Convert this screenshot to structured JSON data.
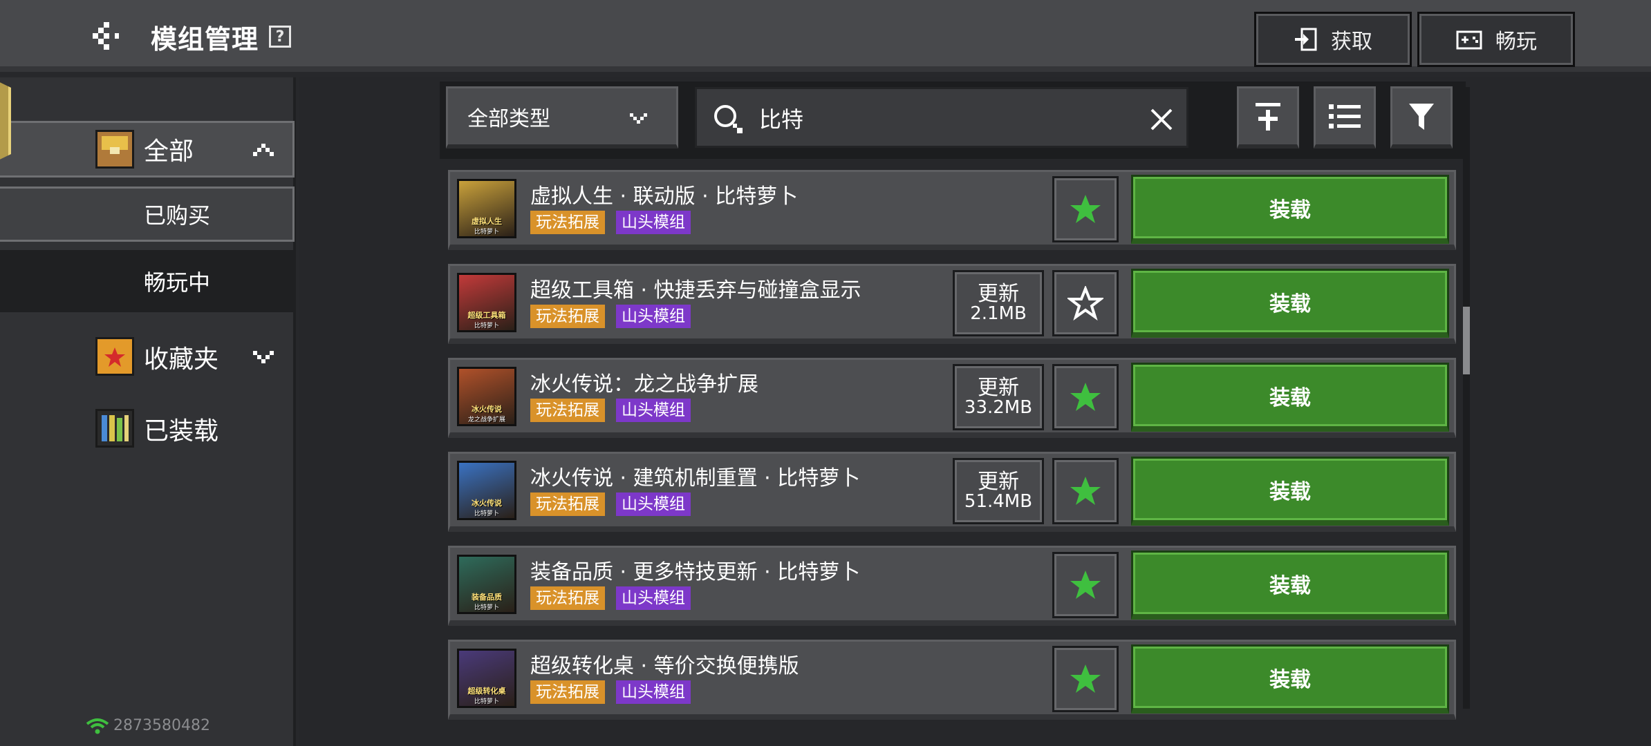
{
  "header": {
    "title": "模组管理",
    "help_icon": "question-icon",
    "back_icon": "back-arrow-icon",
    "get_label": "获取",
    "play_label": "畅玩"
  },
  "sidebar": {
    "all": "全部",
    "bought": "已购买",
    "playing": "畅玩中",
    "favorites": "收藏夹",
    "installed": "已装载",
    "net_id": "2873580482"
  },
  "toolbar": {
    "type_select": "全部类型",
    "search_value": "比特"
  },
  "mods": [
    {
      "title": "虚拟人生 · 联动版 · 比特萝卜",
      "tags": [
        "玩法拓展",
        "山头模组"
      ],
      "update": null,
      "favorited": true,
      "action": "装载",
      "thumb_text": [
        "虚拟人生",
        "比特萝卜"
      ],
      "thumb_color": "#c9a13b"
    },
    {
      "title": "超级工具箱 · 快捷丢弃与碰撞盒显示",
      "tags": [
        "玩法拓展",
        "山头模组"
      ],
      "update": {
        "label": "更新",
        "size": "2.1MB"
      },
      "favorited": false,
      "action": "装载",
      "thumb_text": [
        "超级工具箱",
        "比特萝卜"
      ],
      "thumb_color": "#c23a3a"
    },
    {
      "title": "冰火传说：龙之战争扩展",
      "tags": [
        "玩法拓展",
        "山头模组"
      ],
      "update": {
        "label": "更新",
        "size": "33.2MB"
      },
      "favorited": true,
      "action": "装载",
      "thumb_text": [
        "冰火传说",
        "龙之战争扩展"
      ],
      "thumb_color": "#b0512a"
    },
    {
      "title": "冰火传说 · 建筑机制重置 · 比特萝卜",
      "tags": [
        "玩法拓展",
        "山头模组"
      ],
      "update": {
        "label": "更新",
        "size": "51.4MB"
      },
      "favorited": true,
      "action": "装载",
      "thumb_text": [
        "冰火传说",
        "比特萝卜"
      ],
      "thumb_color": "#3a72c2"
    },
    {
      "title": "装备品质 · 更多特技更新 · 比特萝卜",
      "tags": [
        "玩法拓展",
        "山头模组"
      ],
      "update": null,
      "favorited": true,
      "action": "装载",
      "thumb_text": [
        "装备品质",
        "比特萝卜"
      ],
      "thumb_color": "#2e6b5b"
    },
    {
      "title": "超级转化桌 · 等价交换便携版",
      "tags": [
        "玩法拓展",
        "山头模组"
      ],
      "update": null,
      "favorited": true,
      "action": "装载",
      "thumb_text": [
        "超级转化桌",
        "比特萝卜"
      ],
      "thumb_color": "#4a3a7a"
    }
  ],
  "colors": {
    "load_green": "#3c8a2a",
    "star_green": "#3fbf3f",
    "tag_orange": "#d9922a",
    "tag_purple": "#7d38c9"
  }
}
